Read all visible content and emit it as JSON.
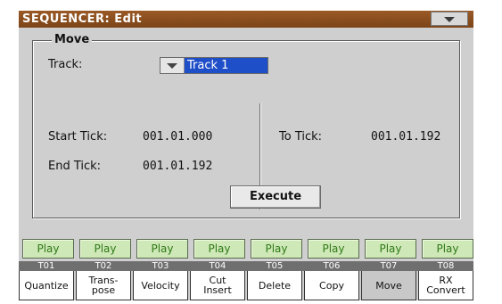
{
  "header": {
    "title": "SEQUENCER: Edit",
    "menu_icon": "triangle-down-icon"
  },
  "move_group": {
    "title": "Move",
    "track_label": "Track:",
    "track_value": "Track 1",
    "start_tick_label": "Start Tick:",
    "start_tick_value": "001.01.000",
    "end_tick_label": "End Tick:",
    "end_tick_value": "001.01.192",
    "to_tick_label": "To Tick:",
    "to_tick_value": "001.01.192",
    "execute_label": "Execute"
  },
  "tracks": [
    {
      "play": "Play",
      "id": "T01"
    },
    {
      "play": "Play",
      "id": "T02"
    },
    {
      "play": "Play",
      "id": "T03"
    },
    {
      "play": "Play",
      "id": "T04"
    },
    {
      "play": "Play",
      "id": "T05"
    },
    {
      "play": "Play",
      "id": "T06"
    },
    {
      "play": "Play",
      "id": "T07"
    },
    {
      "play": "Play",
      "id": "T08"
    }
  ],
  "tabs": [
    {
      "label": "Quantize"
    },
    {
      "label": "Trans-\npose"
    },
    {
      "label": "Velocity"
    },
    {
      "label": "Cut\nInsert"
    },
    {
      "label": "Delete"
    },
    {
      "label": "Copy"
    },
    {
      "label": "Move",
      "active": true
    },
    {
      "label": "RX\nConvert"
    }
  ],
  "colors": {
    "title_bar": "#8b4f22",
    "panel": "#cfcfcf",
    "selection": "#1f4ec9",
    "play_text": "#2f7a17"
  }
}
